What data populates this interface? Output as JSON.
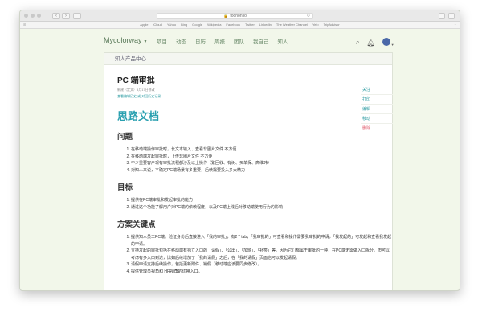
{
  "browser": {
    "url": "foonon.io",
    "bookmarks": [
      "Apple",
      "iCloud",
      "Yahoo",
      "Bing",
      "Google",
      "Wikipedia",
      "Facebook",
      "Twitter",
      "LinkedIn",
      "The Weather Channel",
      "Yelp",
      "TripAdvisor"
    ]
  },
  "header": {
    "logo": "Mycolorway",
    "nav": [
      "项目",
      "动态",
      "日历",
      "周报",
      "团队",
      "我自己",
      "知人"
    ]
  },
  "card": {
    "tab_title": "知人产品中心"
  },
  "doc": {
    "title": "PC 端审批",
    "meta": "新建（定文）3月17日修改",
    "links": "查看编辑历史 或 对回历史记录",
    "heading": "思路文档",
    "sections": [
      {
        "title": "问题",
        "items": [
          "在移动端操作审批时，长文本输入、查看非图片文件  不方便",
          "在移动端发起审批时，上传非图片文件  不方便",
          "不少重要客户现有审批流程都涉及以上操作（繁回收、有树、买单保、高维玮）",
          "对知人来说，不确定PC端场景有多重要，后续需要投入多大精力"
        ]
      },
      {
        "title": "目标",
        "items": [
          "提供在PC端审批和发起审批的能力",
          "通过这个功能了解用户对PC端的依赖程度，以及PC端上线后对移动端使用行为的影响"
        ]
      },
      {
        "title": "方案关键点",
        "items": [
          "提供知人员工PC端。验证身份后直接进入「我的审批」，有2个tab，「我审批的」可查看和操作需要我审批的申请，「我发起的」可发起和查看我发起的申请。",
          "支持发起的审批包括在移动端有独立入口的「请假」、「公出」、「加班」、「补签」等。因为它们都属于审批的一种，在PC端无需做入口拆分。但可以考虑有多入口到达，比如后续增加了「我的请假」之后，在「我的请假」页面也可以发起请假。",
          "请假申请支持后续操作，包括更新附件、销假（移动端应该要同步修改）。",
          "提供管理员视角和 HR视角的切换入口。"
        ]
      }
    ]
  },
  "side_actions": [
    {
      "label": "关注",
      "style": "normal"
    },
    {
      "label": "打印",
      "style": "normal"
    },
    {
      "label": "编辑",
      "style": "normal"
    },
    {
      "label": "移动",
      "style": "normal"
    },
    {
      "label": "删除",
      "style": "danger"
    }
  ]
}
